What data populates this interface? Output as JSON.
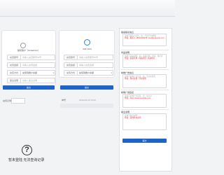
{
  "left_panel": {
    "account_a": "随机客户（Gridadmin）",
    "account_b": "UID:1324",
    "rows": [
      {
        "label": "充值账号",
        "value": "请输入充值账号ID号"
      },
      {
        "label": "充值金额",
        "value": "请输入充值金额"
      },
      {
        "label": "充值方式",
        "value": "充值到账户余额"
      },
      {
        "label": "备注说明",
        "value": "请输入备注说明"
      }
    ],
    "rows_b": [
      {
        "label": "充值账号",
        "value": "请输入充值账号ID号"
      },
      {
        "label": "充值金额",
        "value": "请输入充值金额"
      },
      {
        "label": "充值方式",
        "value": "充值到账户余额"
      }
    ],
    "submit_a": "提交",
    "submit_b": "提交",
    "mini_left": "充值记录",
    "mini_right_label": "单号",
    "mini_right_date": "2020-06-19 19:20",
    "empty_text": "暂未登陆 无法查询记录"
  },
  "right_panel": {
    "sections": [
      {
        "title": "备案联系信息",
        "placeholder": "请填写联系人信息，如：手机号码/邮箱",
        "example": "例如：联系人 18812345678 / test@example.com"
      },
      {
        "title": "商品说明",
        "placeholder": "请填写商品说明，如：商品名称、用途、特点等",
        "example": "例如：商品名称 / 商品用途 / 商品特点"
      },
      {
        "title": "前端广告信息",
        "placeholder": "请填写前端广告信息，如：活动文案等",
        "example": "例如：限时优惠 / 活动说明"
      },
      {
        "title": "前端广告链接",
        "placeholder": "请填写前端广告链接，如：https://",
        "example": "例如：https://www.example.com"
      },
      {
        "title": "备注说明",
        "placeholder": "请填写备注说明",
        "example": "例如：其他补充说明"
      }
    ],
    "submit": "提交"
  }
}
